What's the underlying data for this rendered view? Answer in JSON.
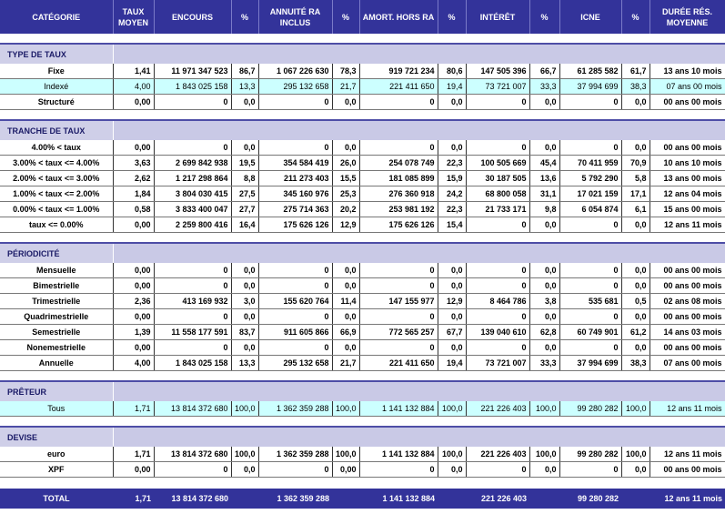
{
  "headers": [
    "CATÉGORIE",
    "TAUX MOYEN",
    "ENCOURS",
    "%",
    "ANNUITÉ RA INCLUS",
    "%",
    "AMORT. HORS RA",
    "%",
    "INTÉRÊT",
    "%",
    "ICNE",
    "%",
    "DURÉE RÉS. MOYENNE"
  ],
  "sections": [
    {
      "title": "TYPE DE TAUX",
      "rows": [
        {
          "style": "bold",
          "cells": [
            "Fixe",
            "1,41",
            "11 971 347 523",
            "86,7",
            "1 067 226 630",
            "78,3",
            "919 721 234",
            "80,6",
            "147 505 396",
            "66,7",
            "61 285 582",
            "61,7",
            "13 ans 10 mois"
          ]
        },
        {
          "style": "hl",
          "cells": [
            "Indexé",
            "4,00",
            "1 843 025 158",
            "13,3",
            "295 132 658",
            "21,7",
            "221 411 650",
            "19,4",
            "73 721 007",
            "33,3",
            "37 994 699",
            "38,3",
            "07 ans 00 mois"
          ]
        },
        {
          "style": "bold",
          "cells": [
            "Structuré",
            "0,00",
            "0",
            "0,0",
            "0",
            "0,0",
            "0",
            "0,0",
            "0",
            "0,0",
            "0",
            "0,0",
            "00 ans 00 mois"
          ]
        }
      ]
    },
    {
      "title": "TRANCHE DE TAUX",
      "rows": [
        {
          "style": "bold",
          "cells": [
            "4.00% < taux",
            "0,00",
            "0",
            "0,0",
            "0",
            "0,0",
            "0",
            "0,0",
            "0",
            "0,0",
            "0",
            "0,0",
            "00 ans 00 mois"
          ]
        },
        {
          "style": "bold",
          "cells": [
            "3.00% < taux <= 4.00%",
            "3,63",
            "2 699 842 938",
            "19,5",
            "354 584 419",
            "26,0",
            "254 078 749",
            "22,3",
            "100 505 669",
            "45,4",
            "70 411 959",
            "70,9",
            "10 ans 10 mois"
          ]
        },
        {
          "style": "bold",
          "cells": [
            "2.00% < taux <= 3.00%",
            "2,62",
            "1 217 298 864",
            "8,8",
            "211 273 403",
            "15,5",
            "181 085 899",
            "15,9",
            "30 187 505",
            "13,6",
            "5 792 290",
            "5,8",
            "13 ans 00 mois"
          ]
        },
        {
          "style": "bold",
          "cells": [
            "1.00% < taux <= 2.00%",
            "1,84",
            "3 804 030 415",
            "27,5",
            "345 160 976",
            "25,3",
            "276 360 918",
            "24,2",
            "68 800 058",
            "31,1",
            "17 021 159",
            "17,1",
            "12 ans 04 mois"
          ]
        },
        {
          "style": "bold",
          "cells": [
            "0.00% < taux <= 1.00%",
            "0,58",
            "3 833 400 047",
            "27,7",
            "275 714 363",
            "20,2",
            "253 981 192",
            "22,3",
            "21 733 171",
            "9,8",
            "6 054 874",
            "6,1",
            "15 ans 00 mois"
          ]
        },
        {
          "style": "bold",
          "cells": [
            "taux <= 0.00%",
            "0,00",
            "2 259 800 416",
            "16,4",
            "175 626 126",
            "12,9",
            "175 626 126",
            "15,4",
            "0",
            "0,0",
            "0",
            "0,0",
            "12 ans 11 mois"
          ]
        }
      ]
    },
    {
      "title": "PÉRIODICITÉ",
      "rows": [
        {
          "style": "bold",
          "cells": [
            "Mensuelle",
            "0,00",
            "0",
            "0,0",
            "0",
            "0,0",
            "0",
            "0,0",
            "0",
            "0,0",
            "0",
            "0,0",
            "00 ans 00 mois"
          ]
        },
        {
          "style": "bold",
          "cells": [
            "Bimestrielle",
            "0,00",
            "0",
            "0,0",
            "0",
            "0,0",
            "0",
            "0,0",
            "0",
            "0,0",
            "0",
            "0,0",
            "00 ans 00 mois"
          ]
        },
        {
          "style": "bold",
          "cells": [
            "Trimestrielle",
            "2,36",
            "413 169 932",
            "3,0",
            "155 620 764",
            "11,4",
            "147 155 977",
            "12,9",
            "8 464 786",
            "3,8",
            "535 681",
            "0,5",
            "02 ans 08 mois"
          ]
        },
        {
          "style": "bold",
          "cells": [
            "Quadrimestrielle",
            "0,00",
            "0",
            "0,0",
            "0",
            "0,0",
            "0",
            "0,0",
            "0",
            "0,0",
            "0",
            "0,0",
            "00 ans 00 mois"
          ]
        },
        {
          "style": "bold",
          "cells": [
            "Semestrielle",
            "1,39",
            "11 558 177 591",
            "83,7",
            "911 605 866",
            "66,9",
            "772 565 257",
            "67,7",
            "139 040 610",
            "62,8",
            "60 749 901",
            "61,2",
            "14 ans 03 mois"
          ]
        },
        {
          "style": "bold",
          "cells": [
            "Nonemestrielle",
            "0,00",
            "0",
            "0,0",
            "0",
            "0,0",
            "0",
            "0,0",
            "0",
            "0,0",
            "0",
            "0,0",
            "00 ans 00 mois"
          ]
        },
        {
          "style": "bold",
          "cells": [
            "Annuelle",
            "4,00",
            "1 843 025 158",
            "13,3",
            "295 132 658",
            "21,7",
            "221 411 650",
            "19,4",
            "73 721 007",
            "33,3",
            "37 994 699",
            "38,3",
            "07 ans 00 mois"
          ]
        }
      ]
    },
    {
      "title": "PRÊTEUR",
      "rows": [
        {
          "style": "hl",
          "cells": [
            "Tous",
            "1,71",
            "13 814 372 680",
            "100,0",
            "1 362 359 288",
            "100,0",
            "1 141 132 884",
            "100,0",
            "221 226 403",
            "100,0",
            "99 280 282",
            "100,0",
            "12 ans 11 mois"
          ]
        }
      ]
    },
    {
      "title": "DEVISE",
      "rows": [
        {
          "style": "bold",
          "cells": [
            "euro",
            "1,71",
            "13 814 372 680",
            "100,0",
            "1 362 359 288",
            "100,0",
            "1 141 132 884",
            "100,0",
            "221 226 403",
            "100,0",
            "99 280 282",
            "100,0",
            "12 ans 11 mois"
          ]
        },
        {
          "style": "bold",
          "cells": [
            "XPF",
            "0,00",
            "0",
            "0,0",
            "0",
            "0,00",
            "0",
            "0,0",
            "0",
            "0,0",
            "0",
            "0,0",
            "00 ans 00 mois"
          ]
        }
      ]
    }
  ],
  "total": [
    "TOTAL",
    "1,71",
    "13 814 372 680",
    "",
    "1 362 359 288",
    "",
    "1 141 132 884",
    "",
    "221 226 403",
    "",
    "99 280 282",
    "",
    "12 ans 11 mois"
  ]
}
